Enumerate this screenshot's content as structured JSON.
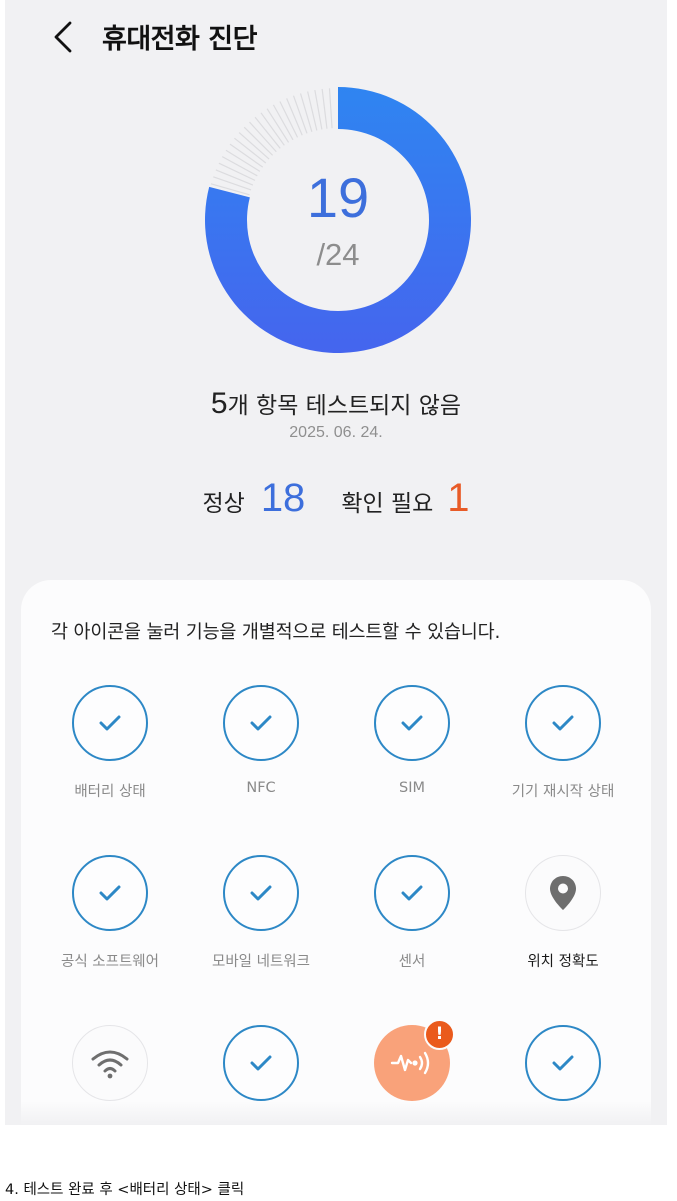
{
  "header": {
    "title": "휴대전화 진단"
  },
  "summary": {
    "score": "19",
    "total": "/24",
    "untested_count": "5",
    "untested_text": "개 항목 테스트되지 않음",
    "date": "2025. 06. 24.",
    "normal_label": "정상",
    "normal_value": "18",
    "check_label": "확인 필요",
    "check_value": "1",
    "progress_fraction": 0.79
  },
  "colors": {
    "accent_blue": "#3d6fdc",
    "warning_orange": "#e85b27",
    "check_ring": "#2d88c6"
  },
  "card": {
    "description": "각 아이콘을 눌러 기능을 개별적으로 테스트할 수 있습니다.",
    "items": [
      {
        "label": "배터리 상태",
        "state": "passed",
        "icon": "check-icon"
      },
      {
        "label": "NFC",
        "state": "passed",
        "icon": "check-icon"
      },
      {
        "label": "SIM",
        "state": "passed",
        "icon": "check-icon"
      },
      {
        "label": "기기 재시작 상태",
        "state": "passed",
        "icon": "check-icon"
      },
      {
        "label": "공식 소프트웨어",
        "state": "passed",
        "icon": "check-icon"
      },
      {
        "label": "모바일 네트워크",
        "state": "passed",
        "icon": "check-icon"
      },
      {
        "label": "센서",
        "state": "passed",
        "icon": "check-icon"
      },
      {
        "label": "위치 정확도",
        "state": "untested",
        "icon": "location-pin-icon"
      },
      {
        "label": "",
        "state": "untested",
        "icon": "wifi-icon"
      },
      {
        "label": "",
        "state": "passed",
        "icon": "check-icon"
      },
      {
        "label": "",
        "state": "needs-check",
        "icon": "vibration-sound-icon",
        "badge": "!"
      },
      {
        "label": "",
        "state": "passed",
        "icon": "check-icon"
      }
    ]
  },
  "caption": "4. 테스트 완료 후 <배터리 상태> 클릭"
}
